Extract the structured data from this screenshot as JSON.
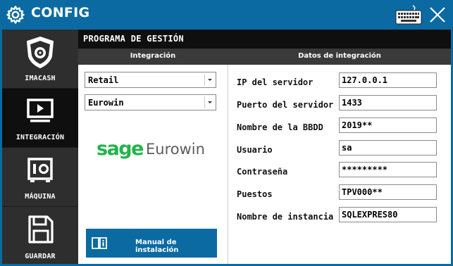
{
  "window": {
    "title": "CONFIG",
    "icons": {
      "title": "gear-icon",
      "keyboard": "keyboard-icon",
      "close": "close-icon"
    },
    "colors": {
      "accent": "#0b6aa2",
      "sidebar": "#2e2e2e",
      "sidebar_active": "#0f0f0f",
      "brand_green": "#24b34b"
    }
  },
  "sidebar": {
    "items": [
      {
        "label": "IMACASH",
        "icon": "safe-shield-icon",
        "active": false
      },
      {
        "label": "INTEGRACIÓN",
        "icon": "monitor-play-icon",
        "active": true
      },
      {
        "label": "MÁQUINA",
        "icon": "machine-icon",
        "active": false
      },
      {
        "label": "GUARDAR",
        "icon": "floppy-disk-icon",
        "active": false
      }
    ]
  },
  "main": {
    "title": "PROGRAMA DE GESTIÓN",
    "columns": {
      "left": "Integración",
      "right": "Datos de integración"
    },
    "selects": [
      {
        "value": "Retail"
      },
      {
        "value": "Eurowin"
      }
    ],
    "logo": {
      "brand": "sage",
      "product": "Eurowin"
    },
    "manual_button": {
      "label": "Manual de instalación",
      "icon": "book-info-icon"
    },
    "fields": [
      {
        "label": "IP del servidor",
        "value": "127.0.0.1"
      },
      {
        "label": "Puerto del servidor",
        "value": "1433"
      },
      {
        "label": "Nombre de la BBDD",
        "value": "2019**"
      },
      {
        "label": "Usuario",
        "value": "sa"
      },
      {
        "label": "Contraseña",
        "value": "*********"
      },
      {
        "label": "Puestos",
        "value": "TPV000**"
      },
      {
        "label": "Nombre de instancia",
        "value": "SQLEXPRES80"
      }
    ]
  }
}
